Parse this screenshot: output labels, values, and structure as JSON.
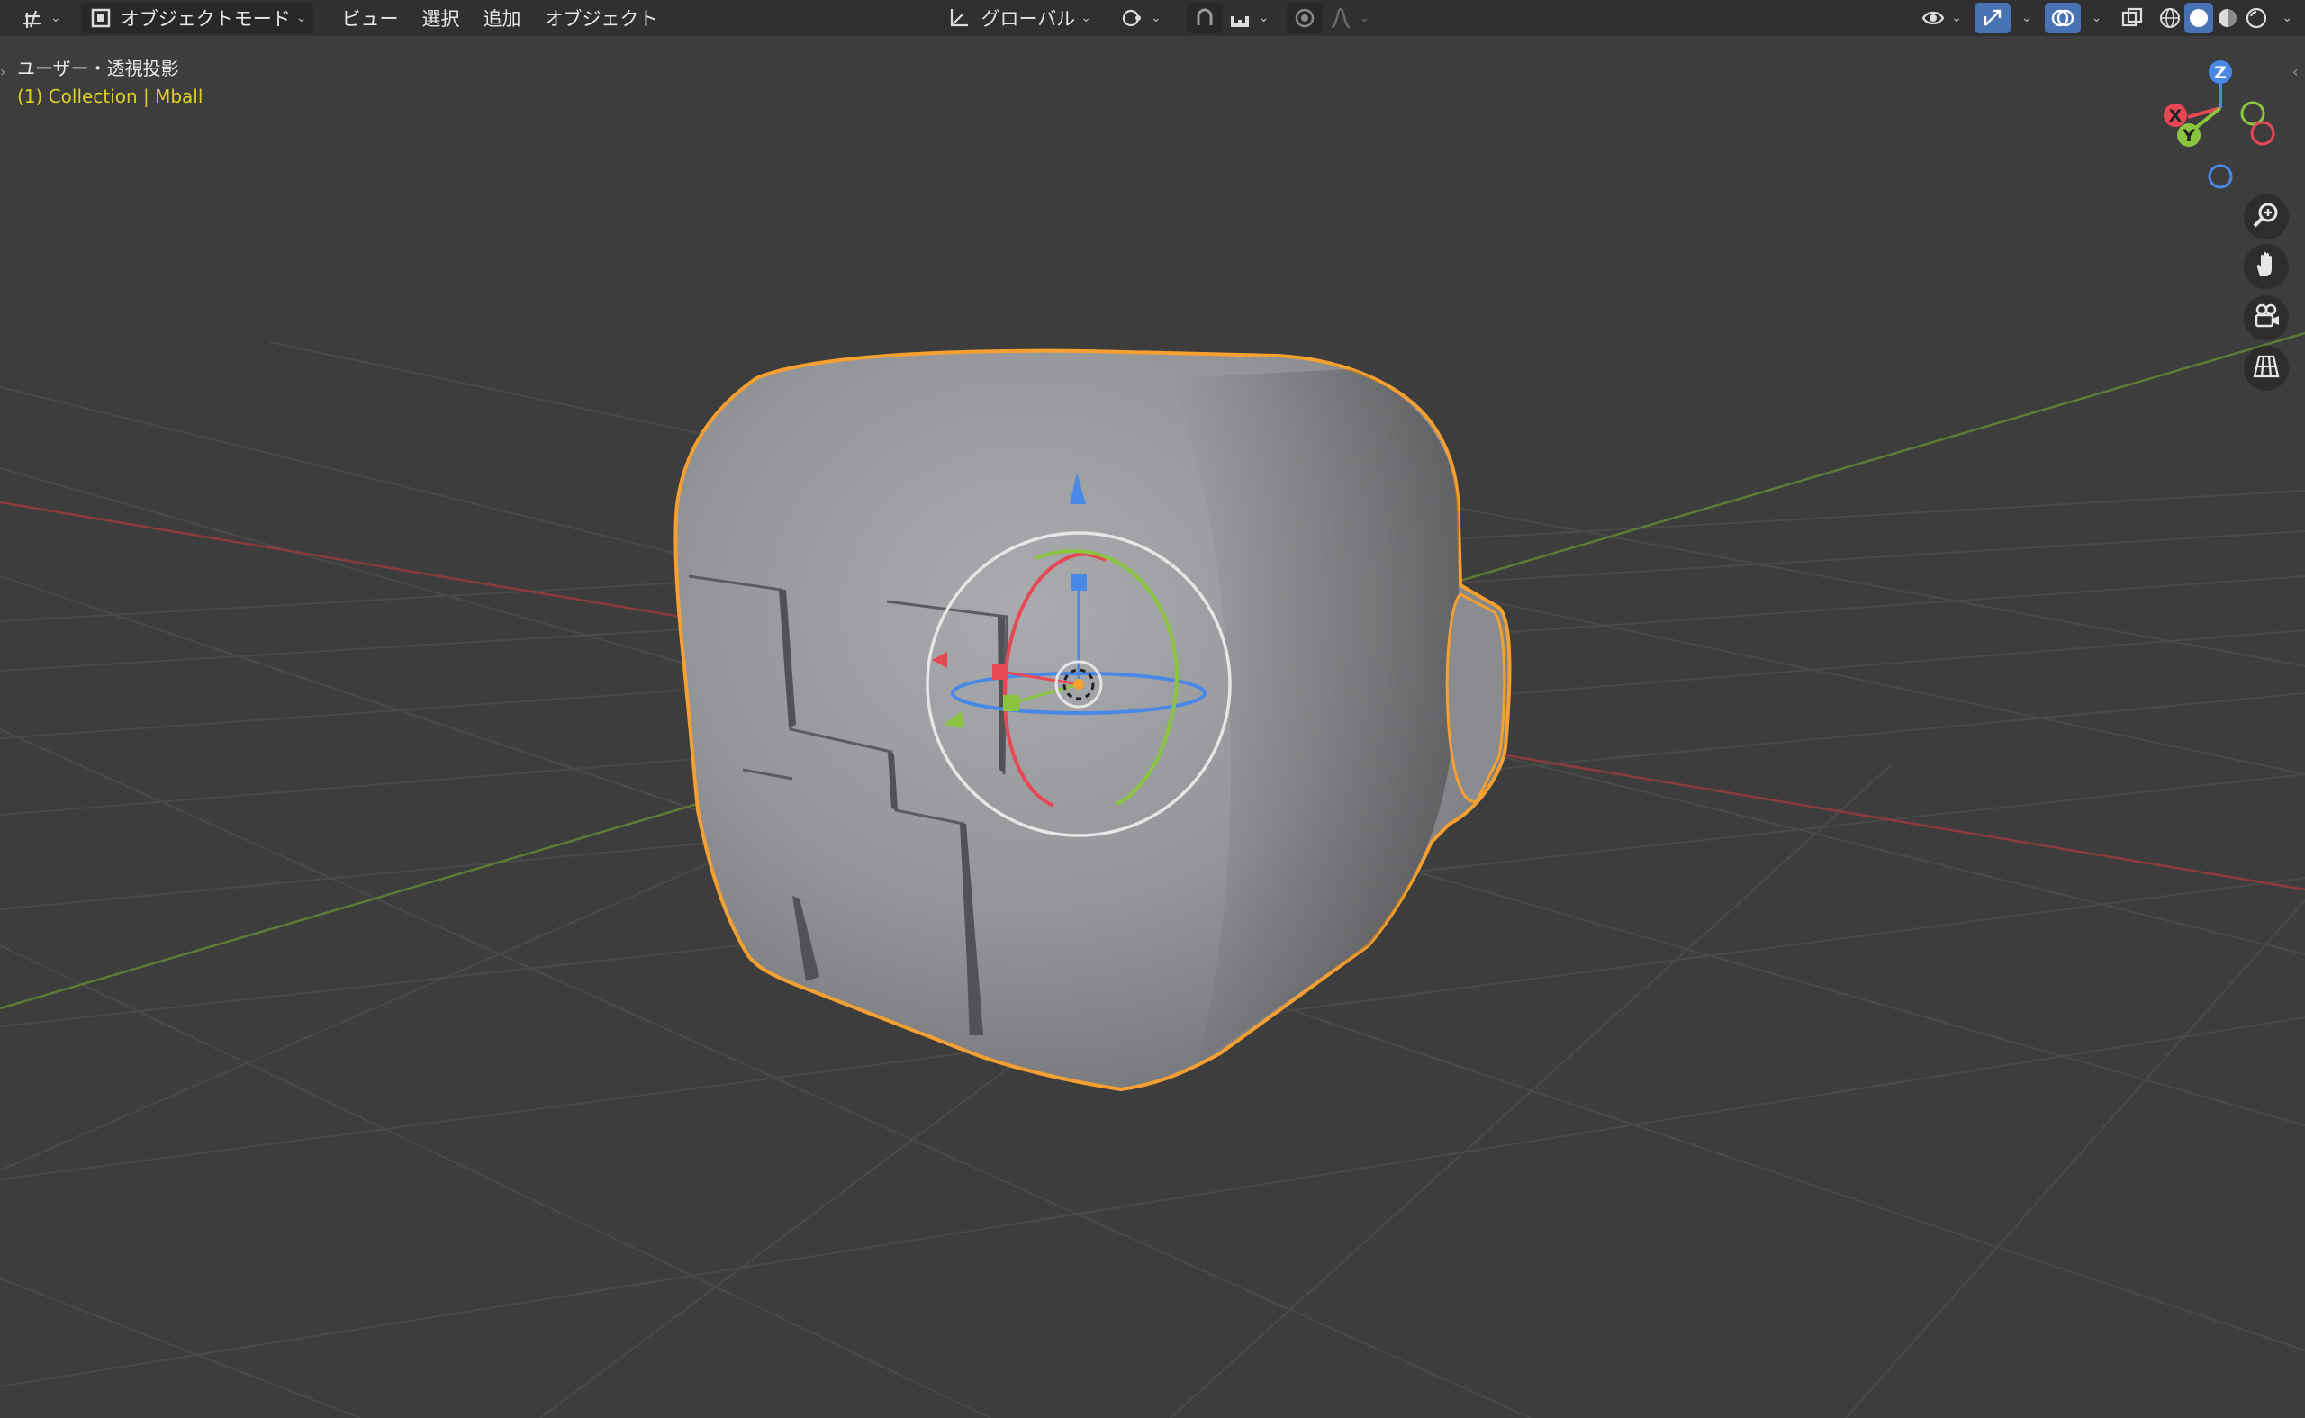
{
  "header": {
    "mode_label": "オブジェクトモード",
    "menus": [
      "ビュー",
      "選択",
      "追加",
      "オブジェクト"
    ],
    "transform_orientation": "グローバル"
  },
  "viewport": {
    "view_label": "ユーザー・透視投影",
    "collection_label": "(1) Collection | Mball"
  },
  "gizmo": {
    "x": "X",
    "y": "Y",
    "z": "Z"
  },
  "icons": {
    "editor_type": "viewport-editor-icon",
    "mode": "object-mode-icon",
    "orientation": "orientation-icon",
    "pivot": "pivot-point-icon",
    "snap": "snap-icon",
    "proportional": "proportional-edit-icon",
    "visibility": "visibility-eye-icon",
    "gizmos": "gizmos-icon",
    "overlays": "overlays-icon",
    "xray": "xray-icon",
    "shading": [
      "wireframe-icon",
      "solid-icon",
      "material-icon",
      "rendered-icon"
    ],
    "nav": [
      "zoom-icon",
      "pan-hand-icon",
      "camera-icon",
      "grid-view-icon"
    ]
  },
  "colors": {
    "selection_outline": "#f5a030",
    "x_axis": "#e84854",
    "y_axis": "#8bc53f",
    "z_axis": "#4a88e8",
    "collection_text": "#e0d024",
    "active_button": "#4772b3"
  }
}
